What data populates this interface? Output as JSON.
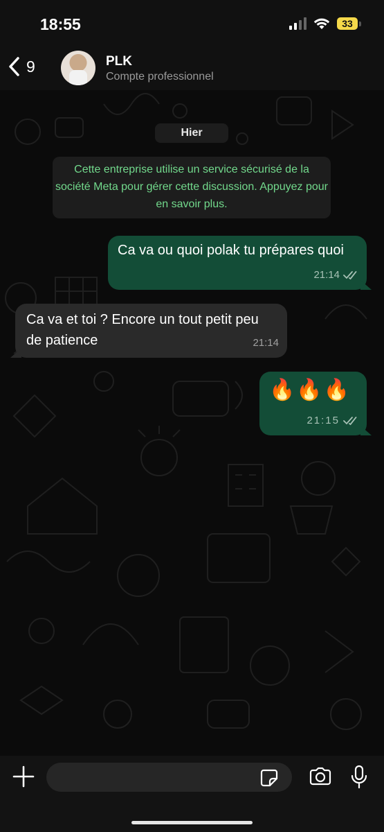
{
  "status_bar": {
    "time": "18:55",
    "battery": "33",
    "battery_color": "#f5d94a"
  },
  "header": {
    "back_count": "9",
    "contact_name": "PLK",
    "contact_subtitle": "Compte professionnel"
  },
  "chat": {
    "date_separator": "Hier",
    "system_notice": "Cette entreprise utilise un service sécurisé de la société Meta pour gérer cette discussion. Appuyez pour en savoir plus.",
    "messages": [
      {
        "direction": "outgoing",
        "text": "Ca va ou quoi polak tu prépares quoi",
        "time": "21:14",
        "status": "read"
      },
      {
        "direction": "incoming",
        "text": "Ca va et toi ? Encore un tout petit peu de patience",
        "time": "21:14"
      },
      {
        "direction": "outgoing",
        "text": "🔥🔥🔥",
        "time": "21:15",
        "status": "read"
      }
    ]
  },
  "input_bar": {
    "placeholder": "",
    "icons": [
      "plus-icon",
      "sticker-icon",
      "camera-icon",
      "microphone-icon"
    ]
  },
  "colors": {
    "outgoing_bubble": "#134d37",
    "incoming_bubble": "#2a2a2a",
    "notice_text": "#72d98c",
    "background": "#0b0b0b"
  }
}
